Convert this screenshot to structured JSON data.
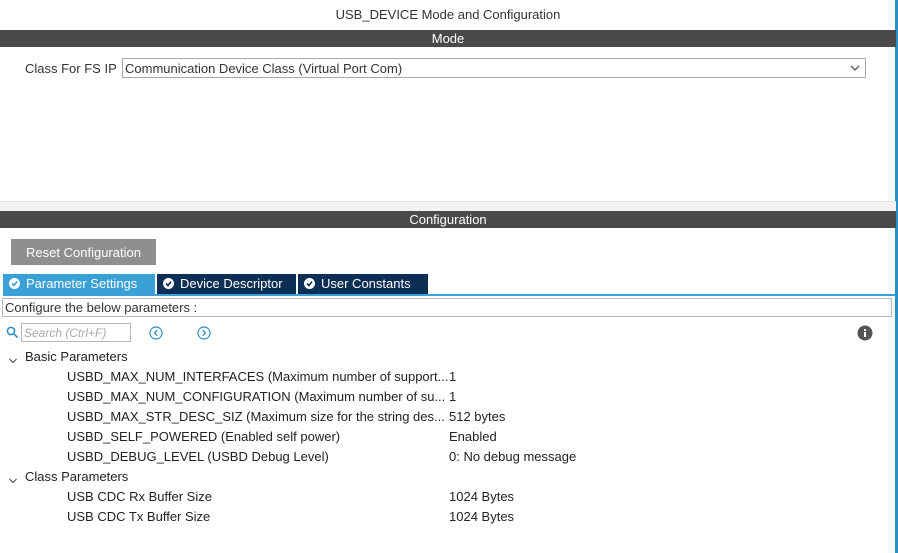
{
  "window": {
    "title": "USB_DEVICE Mode and Configuration"
  },
  "mode": {
    "header": "Mode",
    "class_label": "Class For FS IP",
    "class_value": "Communication Device Class (Virtual Port Com)"
  },
  "configuration": {
    "header": "Configuration",
    "reset_label": "Reset Configuration",
    "tabs": [
      {
        "label": "Parameter Settings",
        "active": true
      },
      {
        "label": "Device Descriptor",
        "active": false
      },
      {
        "label": "User Constants",
        "active": false
      }
    ],
    "description": "Configure the below parameters :",
    "search_placeholder": "Search (Ctrl+F)"
  },
  "groups": [
    {
      "name": "Basic Parameters",
      "params": [
        {
          "name": "USBD_MAX_NUM_INTERFACES (Maximum number of support...",
          "value": "1"
        },
        {
          "name": "USBD_MAX_NUM_CONFIGURATION (Maximum number of su...",
          "value": "1"
        },
        {
          "name": "USBD_MAX_STR_DESC_SIZ (Maximum size for the string des...",
          "value": "512 bytes"
        },
        {
          "name": "USBD_SELF_POWERED (Enabled self power)",
          "value": "Enabled"
        },
        {
          "name": "USBD_DEBUG_LEVEL (USBD Debug Level)",
          "value": "0: No debug message"
        }
      ]
    },
    {
      "name": "Class Parameters",
      "params": [
        {
          "name": "USB CDC Rx Buffer Size",
          "value": "1024 Bytes"
        },
        {
          "name": "USB CDC Tx Buffer Size",
          "value": "1024 Bytes"
        }
      ]
    }
  ],
  "colors": {
    "bar": "#4a4a4a",
    "tab_active": "#3aa0d8",
    "tab_inactive": "#0e2f55",
    "nav_icon": "#2a8fc6"
  }
}
